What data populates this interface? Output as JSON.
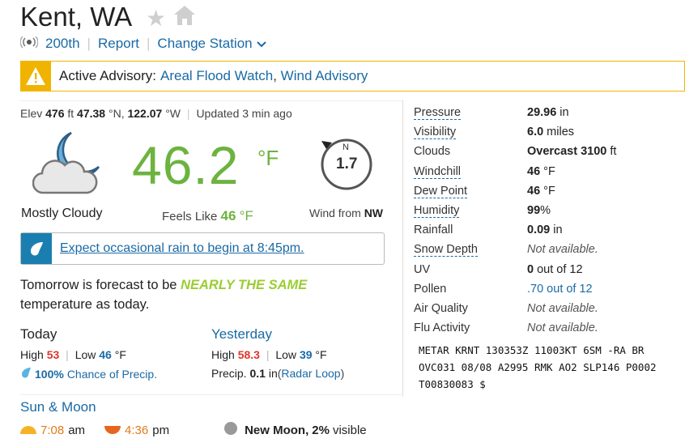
{
  "location": {
    "city": "Kent, WA"
  },
  "subnav": {
    "station": "200th",
    "report": "Report",
    "change_station": "Change Station"
  },
  "advisory": {
    "label": "Active Advisory:",
    "items": [
      "Areal Flood Watch",
      "Wind Advisory"
    ],
    "separator": ", "
  },
  "station_info": {
    "elev_label": "Elev",
    "elev_value": "476",
    "elev_unit": "ft",
    "lat": "47.38",
    "lat_unit": "°N,",
    "lon": "122.07",
    "lon_unit": "°W",
    "updated": "Updated 3 min ago"
  },
  "current": {
    "temperature": "46.2",
    "unit": "°F",
    "condition": "Mostly Cloudy",
    "feels_like_label": "Feels Like",
    "feels_like_value": "46",
    "feels_like_unit": "°F",
    "wind_dir_letter": "N",
    "wind_speed": "1.7",
    "wind_from_label": "Wind from",
    "wind_from_value": "NW"
  },
  "rain_alert": {
    "text": "Expect occasional rain to begin at 8:45pm."
  },
  "tomorrow": {
    "prefix": "Tomorrow is forecast to be",
    "highlight": "NEARLY THE SAME",
    "suffix": "temperature as today."
  },
  "today": {
    "title": "Today",
    "high_label": "High",
    "high": "53",
    "low_label": "Low",
    "low": "46",
    "unit": "°F",
    "precip_pct": "100%",
    "precip_label": "Chance of Precip."
  },
  "yesterday": {
    "title": "Yesterday",
    "high_label": "High",
    "high": "58.3",
    "low_label": "Low",
    "low": "39",
    "unit": "°F",
    "precip_label": "Precip.",
    "precip_value": "0.1",
    "precip_unit": "in",
    "radar_open": "(",
    "radar_label": "Radar Loop",
    "radar_close": ")"
  },
  "conditions": [
    {
      "label": "Pressure",
      "value": "29.96",
      "unit": "in",
      "dotted": true
    },
    {
      "label": "Visibility",
      "value": "6.0",
      "unit": "miles",
      "dotted": true
    },
    {
      "label": "Clouds",
      "value": "Overcast 3100",
      "unit": "ft",
      "dotted": false
    },
    {
      "label": "Windchill",
      "value": "46",
      "unit": "°F",
      "dotted": true
    },
    {
      "label": "Dew Point",
      "value": "46",
      "unit": "°F",
      "dotted": true
    },
    {
      "label": "Humidity",
      "value": "99",
      "unit": "%",
      "dotted": true
    },
    {
      "label": "Rainfall",
      "value": "0.09",
      "unit": "in",
      "dotted": false
    },
    {
      "label": "Snow Depth",
      "value": "",
      "unit": "",
      "na": "Not available.",
      "dotted": true
    },
    {
      "label": "UV",
      "value": "0",
      "unit": "out of 12",
      "dotted": false
    },
    {
      "label": "Pollen",
      "value": "",
      "unit": "",
      "link": ".70 out of 12",
      "dotted": false
    },
    {
      "label": "Air Quality",
      "value": "",
      "unit": "",
      "na": "Not available.",
      "dotted": false
    },
    {
      "label": "Flu Activity",
      "value": "",
      "unit": "",
      "na": "Not available.",
      "dotted": false
    }
  ],
  "metar": "METAR KRNT 130353Z 11003KT 6SM -RA BR OVC031 08/08 A2995 RMK AO2 SLP146 P0002 T00830083 $",
  "sun_moon": {
    "title": "Sun & Moon",
    "sunrise": "7:08",
    "sunrise_suffix": "am",
    "sunset": "4:36",
    "sunset_suffix": "pm",
    "moon_phase": "New Moon,",
    "moon_visible": "2%",
    "moon_visible_suffix": "visible"
  },
  "colors": {
    "accent": "#1a6aa5",
    "temp_green": "#6cb33f",
    "advisory_yellow": "#f0b400",
    "high_red": "#e0352b"
  }
}
